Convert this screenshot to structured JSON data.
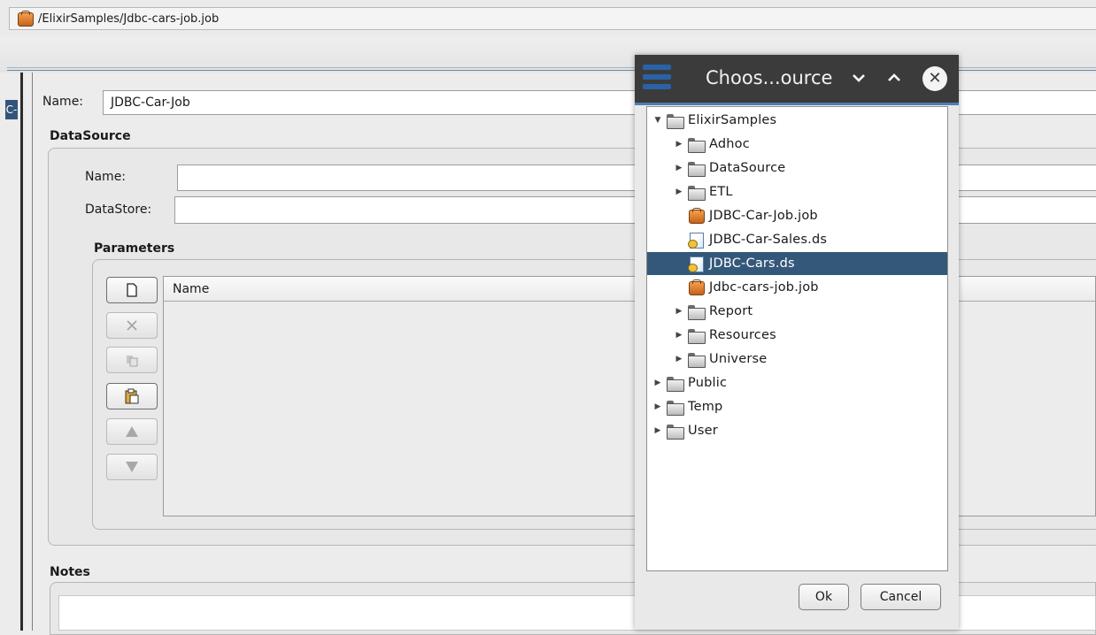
{
  "window": {
    "path": "/ElixirSamples/Jdbc-cars-job.job"
  },
  "side_tab": {
    "label": "C-"
  },
  "job": {
    "name_label": "Name:",
    "name_value": "JDBC-Car-Job"
  },
  "datasource": {
    "title": "DataSource",
    "name_label": "Name:",
    "name_value": "",
    "datastore_label": "DataStore:",
    "datastore_value": ""
  },
  "parameters": {
    "title": "Parameters",
    "column_name": "Name",
    "buttons": [
      {
        "icon": "new-icon",
        "enabled": true
      },
      {
        "icon": "delete-icon",
        "enabled": false
      },
      {
        "icon": "copy-icon",
        "enabled": false
      },
      {
        "icon": "paste-icon",
        "enabled": true
      },
      {
        "icon": "move-up-icon",
        "enabled": false
      },
      {
        "icon": "move-down-icon",
        "enabled": false
      }
    ]
  },
  "notes": {
    "title": "Notes"
  },
  "dialog": {
    "title": "Choos...ource",
    "controls": {
      "minimize": "⌄",
      "maximize": "⌃",
      "close": "✕"
    },
    "tree": [
      {
        "label": "ElixirSamples",
        "type": "folder",
        "toggle": "▼",
        "selected": false
      },
      {
        "label": "Adhoc",
        "type": "folder",
        "toggle": "▶",
        "selected": false
      },
      {
        "label": "DataSource",
        "type": "folder",
        "toggle": "▶",
        "selected": false
      },
      {
        "label": "ETL",
        "type": "folder",
        "toggle": "▶",
        "selected": false
      },
      {
        "label": "JDBC-Car-Job.job",
        "type": "job",
        "toggle": "",
        "selected": false
      },
      {
        "label": "JDBC-Car-Sales.ds",
        "type": "ds",
        "toggle": "",
        "selected": false
      },
      {
        "label": "JDBC-Cars.ds",
        "type": "ds",
        "toggle": "",
        "selected": true
      },
      {
        "label": "Jdbc-cars-job.job",
        "type": "job",
        "toggle": "",
        "selected": false
      },
      {
        "label": "Report",
        "type": "folder",
        "toggle": "▶",
        "selected": false
      },
      {
        "label": "Resources",
        "type": "folder",
        "toggle": "▶",
        "selected": false
      },
      {
        "label": "Universe",
        "type": "folder",
        "toggle": "▶",
        "selected": false
      },
      {
        "label": "Public",
        "type": "folder",
        "toggle": "▶",
        "selected": false
      },
      {
        "label": "Temp",
        "type": "folder",
        "toggle": "▶",
        "selected": false
      },
      {
        "label": "User",
        "type": "folder",
        "toggle": "▶",
        "selected": false
      }
    ],
    "ok_label": "Ok",
    "cancel_label": "Cancel"
  },
  "colors": {
    "selection": "#34587a",
    "title_bar": "#3b3b3b",
    "accent": "#4b7fb4"
  }
}
